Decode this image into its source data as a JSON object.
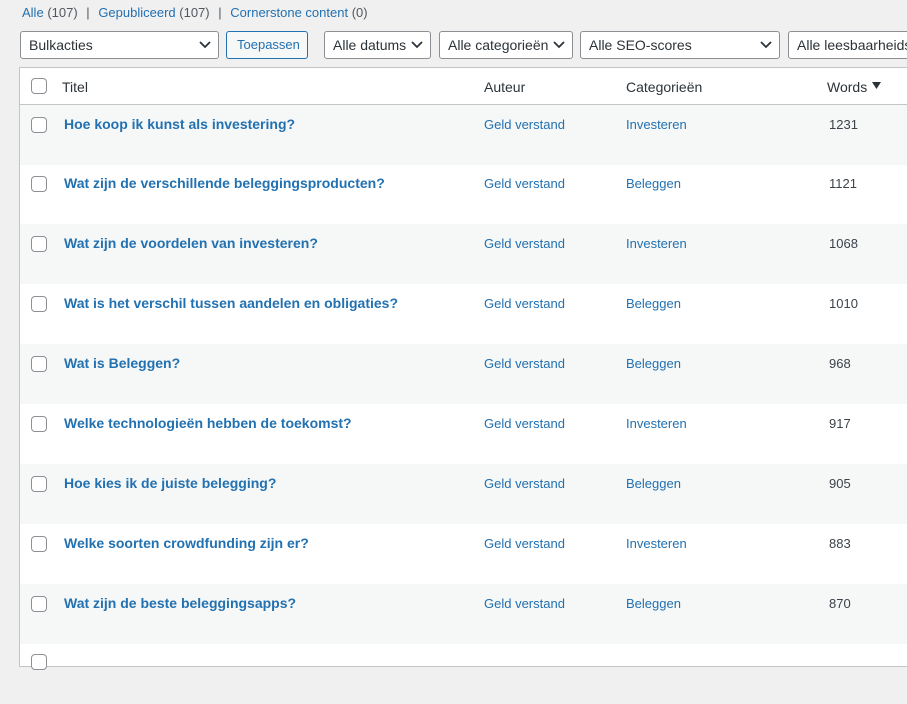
{
  "filters": {
    "all_label": "Alle",
    "all_count": "(107)",
    "published_label": "Gepubliceerd",
    "published_count": "(107)",
    "cornerstone_label": "Cornerstone content",
    "cornerstone_count": "(0)",
    "separator": "|"
  },
  "tablenav": {
    "bulk_actions": "Bulkacties",
    "apply_label": "Toepassen",
    "dates": "Alle datums",
    "categories": "Alle categorieën",
    "seo_scores": "Alle SEO-scores",
    "readability": "Alle leesbaarheidsscores"
  },
  "table": {
    "columns": {
      "title": "Titel",
      "author": "Auteur",
      "categories": "Categorieën",
      "words": "Words"
    },
    "rows": [
      {
        "title": "Hoe koop ik kunst als investering?",
        "author": "Geld verstand",
        "category": "Investeren",
        "words": "1231"
      },
      {
        "title": "Wat zijn de verschillende beleggingsproducten?",
        "author": "Geld verstand",
        "category": "Beleggen",
        "words": "1121"
      },
      {
        "title": "Wat zijn de voordelen van investeren?",
        "author": "Geld verstand",
        "category": "Investeren",
        "words": "1068"
      },
      {
        "title": "Wat is het verschil tussen aandelen en obligaties?",
        "author": "Geld verstand",
        "category": "Beleggen",
        "words": "1010"
      },
      {
        "title": "Wat is Beleggen?",
        "author": "Geld verstand",
        "category": "Beleggen",
        "words": "968"
      },
      {
        "title": "Welke technologieën hebben de toekomst?",
        "author": "Geld verstand",
        "category": "Investeren",
        "words": "917"
      },
      {
        "title": "Hoe kies ik de juiste belegging?",
        "author": "Geld verstand",
        "category": "Beleggen",
        "words": "905"
      },
      {
        "title": "Welke soorten crowdfunding zijn er?",
        "author": "Geld verstand",
        "category": "Investeren",
        "words": "883"
      },
      {
        "title": "Wat zijn de beste beleggingsapps?",
        "author": "Geld verstand",
        "category": "Beleggen",
        "words": "870"
      }
    ]
  },
  "icons": {
    "dropdown": "chevron-down-icon",
    "sort": "sort-down-icon"
  },
  "colors": {
    "link": "#2271b1",
    "background": "#f0f0f1",
    "row_alt": "#f6f7f7",
    "border": "#c3c4c7"
  }
}
